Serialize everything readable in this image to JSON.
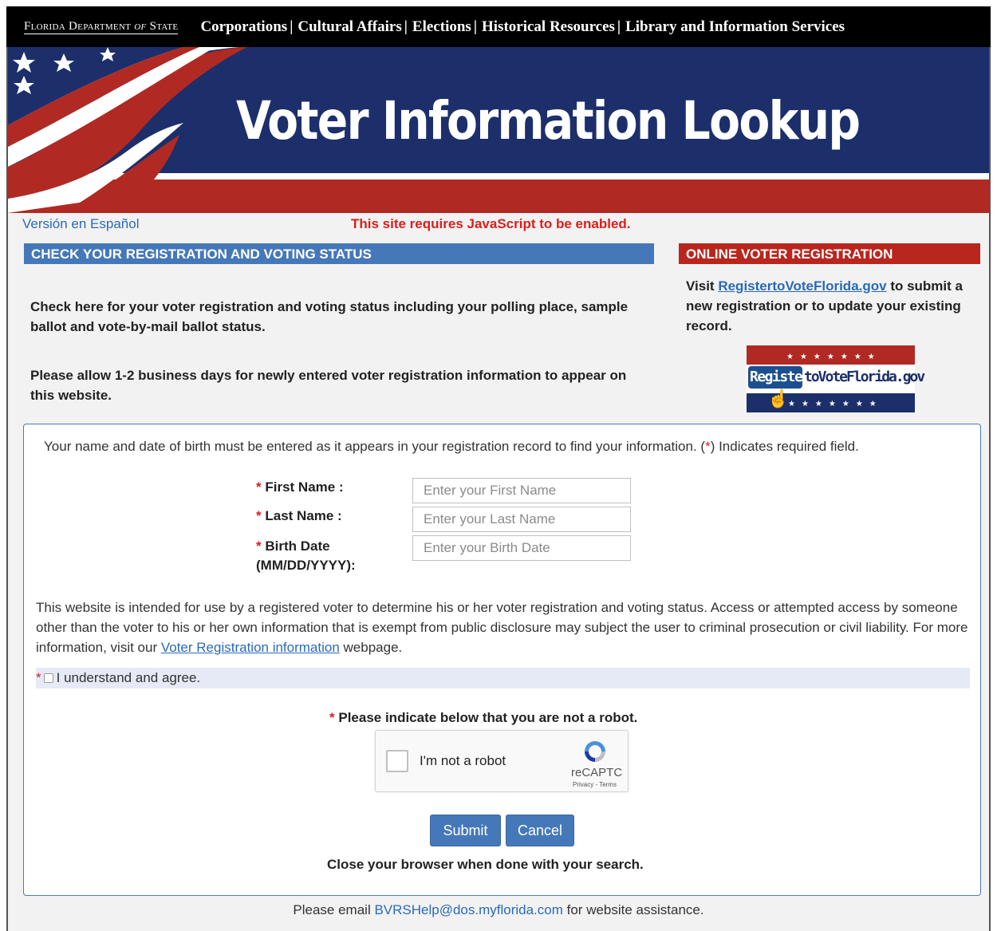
{
  "topnav": {
    "agency_prefix": "Florida Department",
    "agency_of": "of",
    "agency_suffix": "State",
    "links": [
      "Corporations",
      "Cultural Affairs",
      "Elections",
      "Historical Resources",
      "Library and Information Services"
    ]
  },
  "banner": {
    "title": "Voter Information Lookup"
  },
  "espanol_link": "Versión en Español",
  "js_warning": "This site requires JavaScript to be enabled.",
  "check_section": {
    "header": "CHECK YOUR REGISTRATION AND VOTING STATUS",
    "paragraph1": "Check here for your voter registration and voting status including your polling place, sample ballot and vote-by-mail ballot status.",
    "paragraph2": "Please allow 1-2 business days for newly entered voter registration information to appear on this website."
  },
  "online_section": {
    "header": "ONLINE VOTER REGISTRATION",
    "visit": "Visit",
    "link": "RegistertoVoteFlorida.gov",
    "text_after": " to submit a new registration or to update your existing record.",
    "logo_register": "Register",
    "logo_rest": "toVoteFlorida.gov"
  },
  "form": {
    "note": "Your name and date of birth must be entered as it appears in your registration record to find your information. (",
    "note_star": "*",
    "note_end": ") Indicates required field.",
    "first_name_label": "First Name :",
    "last_name_label": "Last Name :",
    "birth_date_label": "Birth Date",
    "birth_date_format": "(MM/DD/YYYY):",
    "first_name_placeholder": "Enter your First Name",
    "last_name_placeholder": "Enter your Last Name",
    "birth_date_placeholder": "Enter your Birth Date",
    "required_star": "*",
    "disclaimer": "This website is intended for use by a registered voter to determine his or her voter registration and voting status. Access or attempted access by someone other than the voter to his or her own information that is exempt from public disclosure may subject the user to criminal prosecution or civil liability. For more information, visit our ",
    "disclaimer_link": "Voter Registration information",
    "disclaimer_end": " webpage.",
    "agree_label": "I understand and agree.",
    "robot_prompt": "Please indicate below that you are not a robot.",
    "captcha_text": "I'm not a robot",
    "captcha_brand": "reCAPTC",
    "captcha_terms": "Privacy - Terms",
    "submit_label": "Submit",
    "cancel_label": "Cancel",
    "close_note": "Close your browser when done with your search."
  },
  "footer": {
    "before": "Please email ",
    "email": "BVRSHelp@dos.myflorida.com",
    "after": " for website assistance."
  },
  "colors": {
    "nav_bg": "#000000",
    "banner_blue": "#1c2f6b",
    "banner_red": "#b02a23",
    "header_blue": "#4578b8",
    "header_red": "#b9261e",
    "link": "#2a6ab8",
    "required": "#d9201c"
  }
}
